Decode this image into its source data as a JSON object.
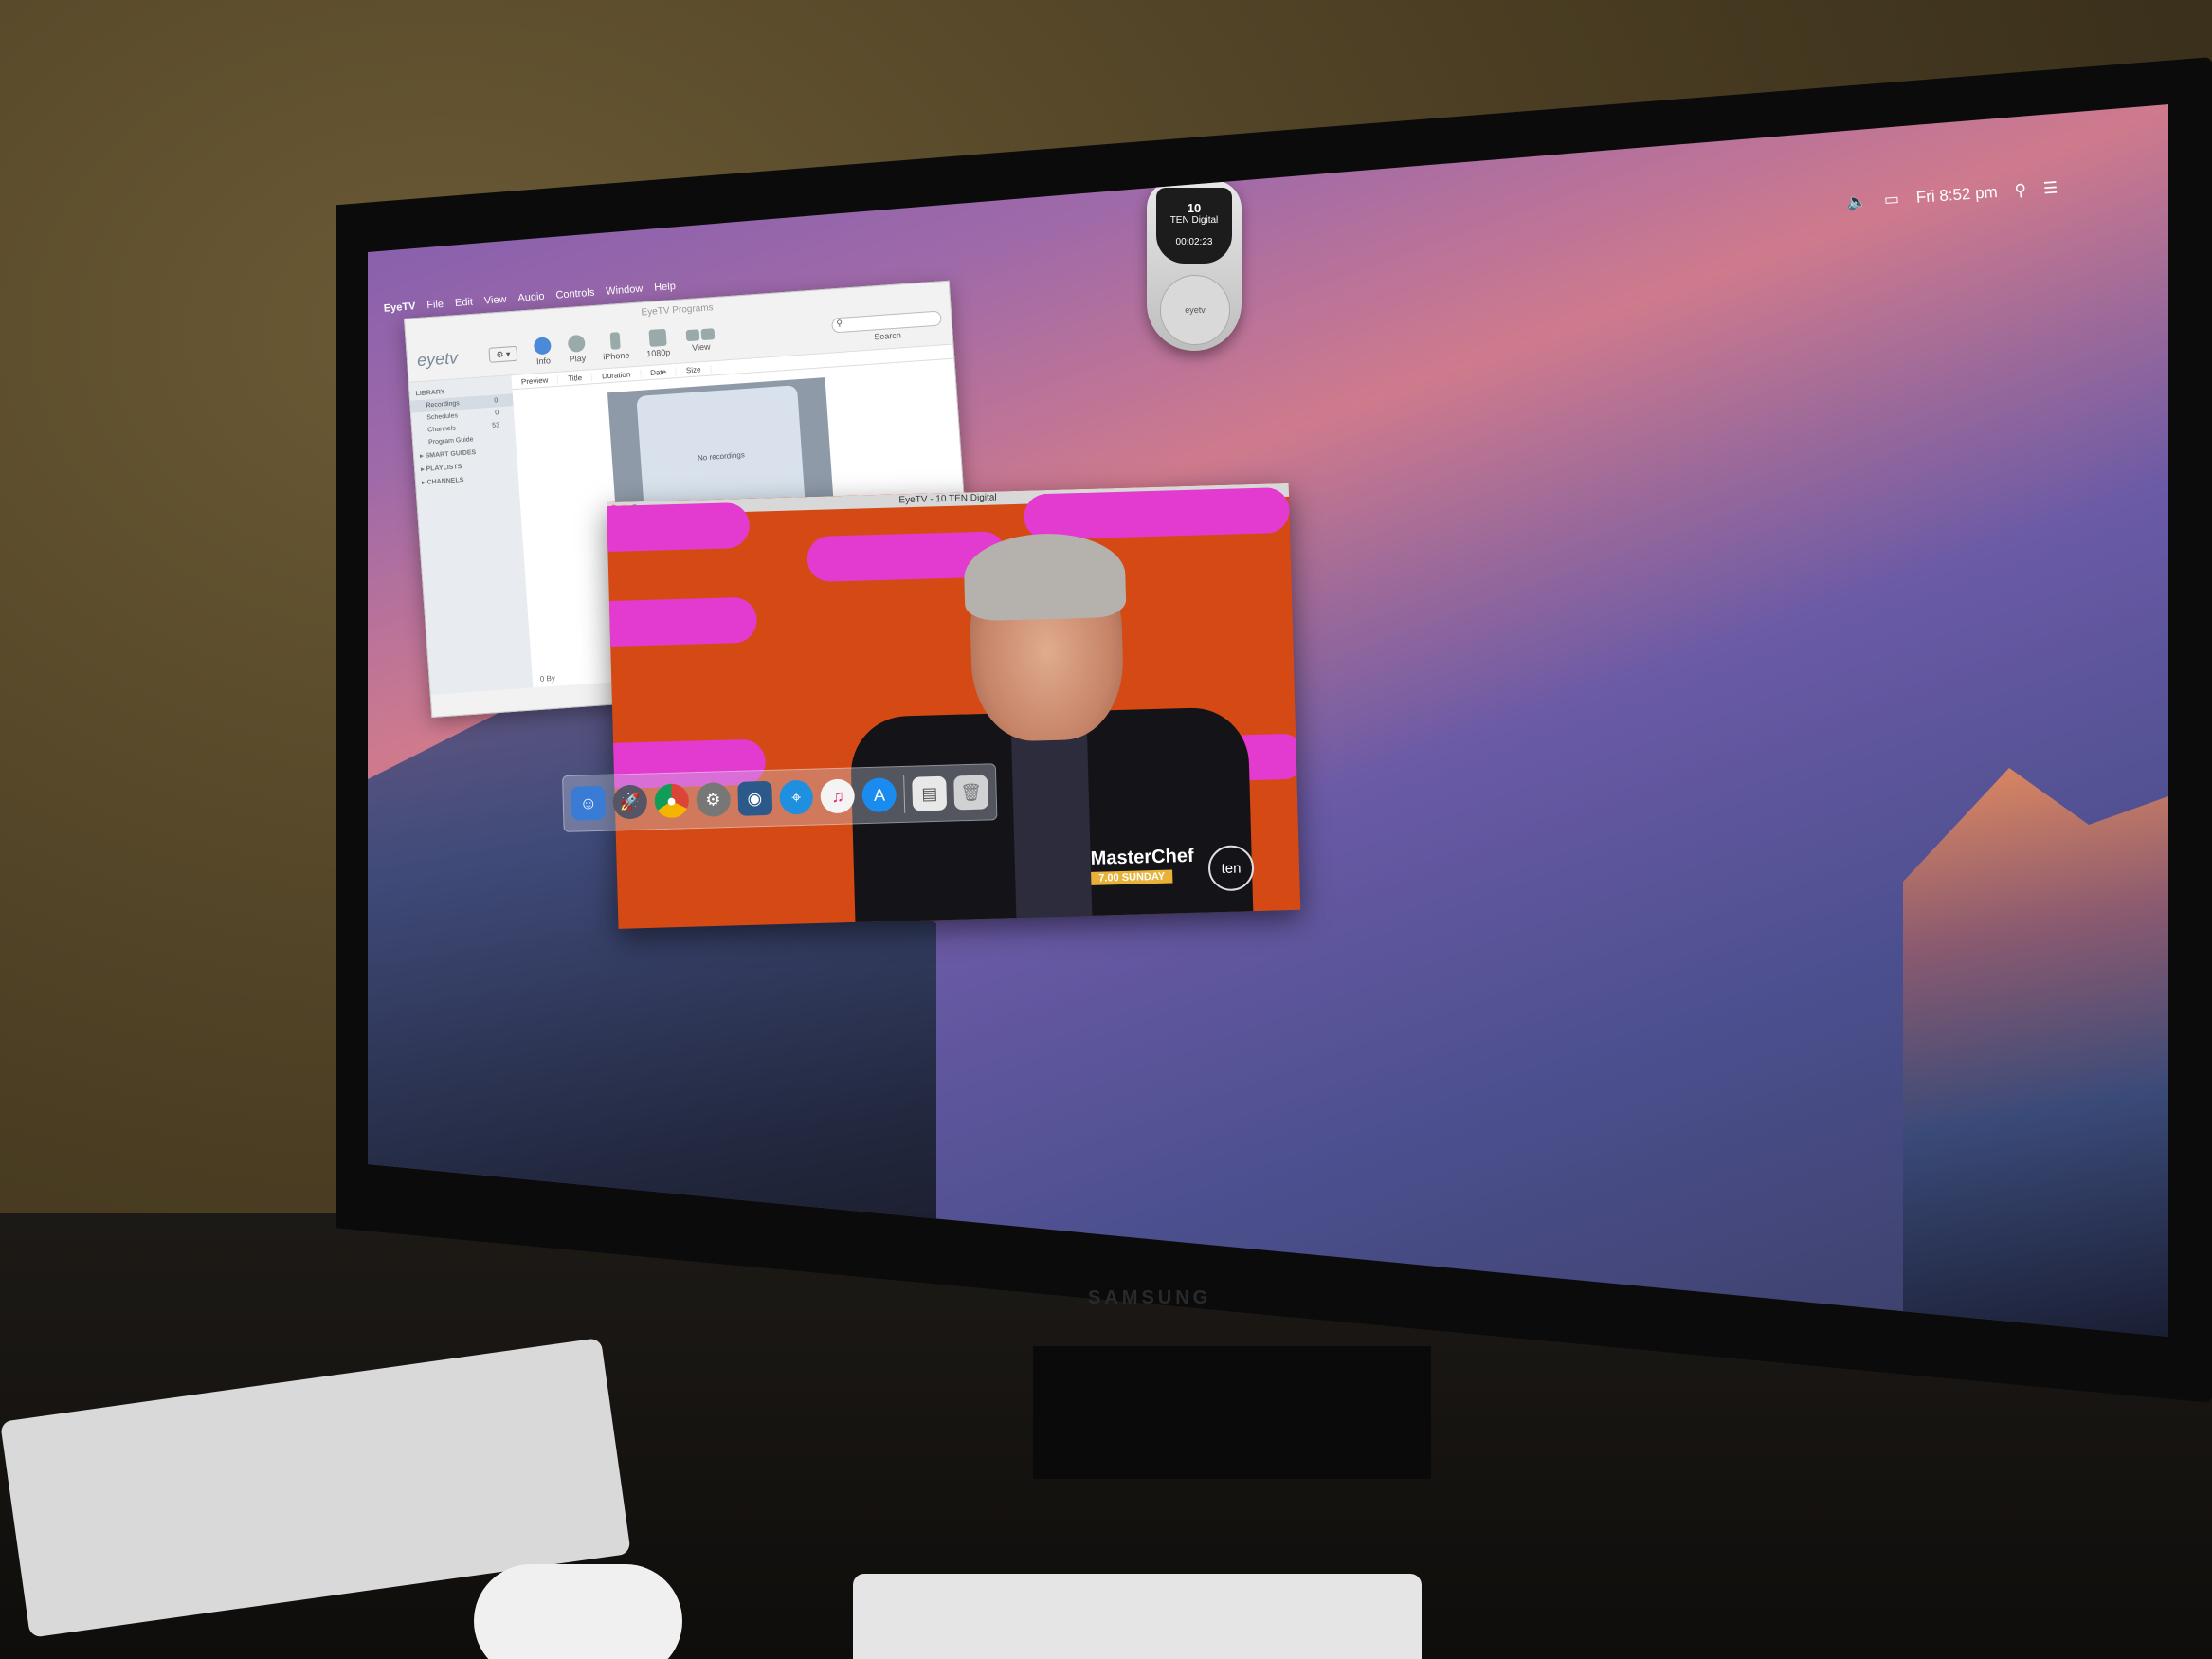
{
  "menubar": {
    "app": "EyeTV",
    "items": [
      "File",
      "Edit",
      "View",
      "Audio",
      "Controls",
      "Window",
      "Help"
    ],
    "clock": "Fri 8:52 pm"
  },
  "programs_window": {
    "title": "EyeTV Programs",
    "logo": "eyetv",
    "toolbar": {
      "info": "Info",
      "play": "Play",
      "iphone": "iPhone",
      "hd": "1080p",
      "view": "View",
      "search_label": "Search",
      "search_placeholder": ""
    },
    "sidebar": {
      "library": "LIBRARY",
      "items": [
        {
          "label": "Recordings",
          "count": "0"
        },
        {
          "label": "Schedules",
          "count": "0"
        },
        {
          "label": "Channels",
          "count": "53"
        },
        {
          "label": "Program Guide",
          "count": ""
        }
      ],
      "smart_guides": "SMART GUIDES",
      "playlists": "PLAYLISTS",
      "channels": "CHANNELS"
    },
    "columns": [
      "Preview",
      "Title",
      "Duration",
      "Date",
      "Size"
    ],
    "empty_message": "No recordings",
    "footer": "0 By"
  },
  "viewer_window": {
    "title": "EyeTV - 10 TEN Digital",
    "promo_title": "MasterChef",
    "promo_sub": "7.00 SUNDAY",
    "channel_logo": "ten"
  },
  "remote": {
    "channel_number": "10",
    "channel_name": "TEN Digital",
    "elapsed": "00:02:23",
    "logo": "eyetv"
  },
  "dock": {
    "apps": [
      "finder-icon",
      "launchpad-icon",
      "chrome-icon",
      "system-preferences-icon",
      "eyetv-icon",
      "safari-icon",
      "itunes-icon",
      "app-store-icon",
      "document-icon",
      "trash-icon"
    ]
  },
  "monitor_brand": "SAMSUNG"
}
